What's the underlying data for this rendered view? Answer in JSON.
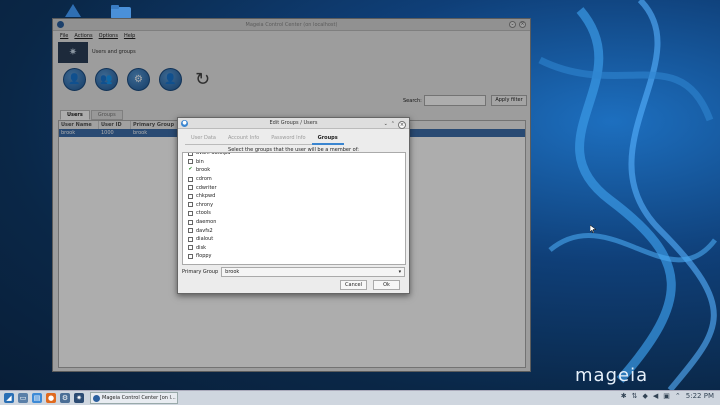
{
  "main_window": {
    "title": "Mageia Control Center (on localhost)",
    "menus": [
      "File",
      "Actions",
      "Options",
      "Help"
    ],
    "banner_text": "Users and groups",
    "search_label": "Search:",
    "search_value": "",
    "apply_filter_label": "Apply filter",
    "tabs": [
      "Users",
      "Groups"
    ],
    "table_headers": [
      "User Name",
      "User ID",
      "Primary Group"
    ],
    "table_row": [
      "brook",
      "1000",
      "brook"
    ]
  },
  "dialog": {
    "title": "Edit Groups / Users",
    "tabs": [
      "User Data",
      "Account Info",
      "Password Info",
      "Groups"
    ],
    "active_tab": "Groups",
    "instruction": "Select the groups that the user will be a member of:",
    "groups": [
      {
        "name": "avahi-autoipd",
        "checked": false
      },
      {
        "name": "bin",
        "checked": false
      },
      {
        "name": "brook",
        "checked": true
      },
      {
        "name": "cdrom",
        "checked": false
      },
      {
        "name": "cdwriter",
        "checked": false
      },
      {
        "name": "chkpwd",
        "checked": false
      },
      {
        "name": "chrony",
        "checked": false
      },
      {
        "name": "ctools",
        "checked": false
      },
      {
        "name": "daemon",
        "checked": false
      },
      {
        "name": "davfs2",
        "checked": false
      },
      {
        "name": "dialout",
        "checked": false
      },
      {
        "name": "disk",
        "checked": false
      },
      {
        "name": "floppy",
        "checked": false
      }
    ],
    "primary_group_label": "Primary Group",
    "primary_group_value": "brook",
    "cancel_label": "Cancel",
    "ok_label": "Ok"
  },
  "taskbar": {
    "task_label": "Mageia Control Center  [on l...",
    "clock": "5:22 PM"
  },
  "desktop": {
    "brand": "mageia"
  }
}
